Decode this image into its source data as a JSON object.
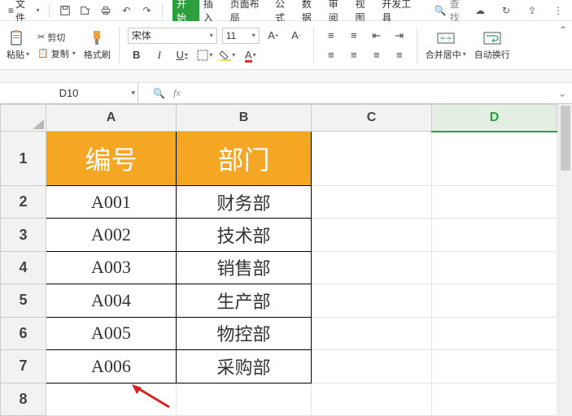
{
  "menu": {
    "file": "文件",
    "tabs": [
      "开始",
      "插入",
      "页面布局",
      "公式",
      "数据",
      "审阅",
      "视图",
      "开发工具"
    ],
    "search": "查找"
  },
  "ribbon": {
    "paste": "粘贴",
    "cut": "剪切",
    "copy": "复制",
    "format_painter": "格式刷",
    "font_name": "宋体",
    "font_size": "11",
    "merge_center": "合并居中",
    "wrap_text": "自动换行"
  },
  "namebox": "D10",
  "columns": [
    "A",
    "B",
    "C",
    "D"
  ],
  "rows": [
    "1",
    "2",
    "3",
    "4",
    "5",
    "6",
    "7",
    "8"
  ],
  "sheet": {
    "headers": {
      "A": "编号",
      "B": "部门"
    },
    "data": [
      {
        "A": "A001",
        "B": "财务部"
      },
      {
        "A": "A002",
        "B": "技术部"
      },
      {
        "A": "A003",
        "B": "销售部"
      },
      {
        "A": "A004",
        "B": "生产部"
      },
      {
        "A": "A005",
        "B": "物控部"
      },
      {
        "A": "A006",
        "B": "采购部"
      }
    ]
  },
  "selected_col": "D"
}
